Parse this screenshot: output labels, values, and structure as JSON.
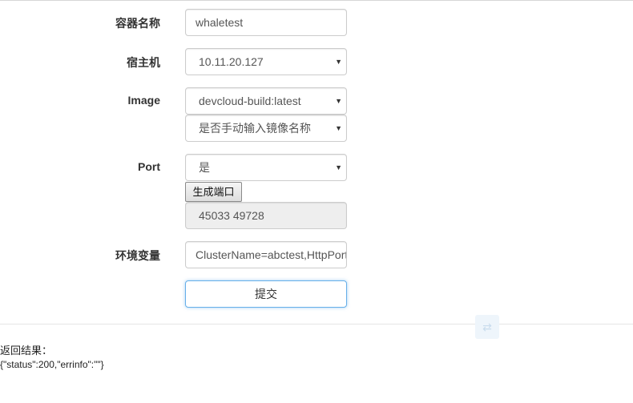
{
  "form": {
    "container_name": {
      "label": "容器名称",
      "value": "whaletest"
    },
    "host": {
      "label": "宿主机",
      "selected": "10.11.20.127"
    },
    "image": {
      "label": "Image",
      "selected": "devcloud-build:latest",
      "manual_selected": "是否手动输入镜像名称"
    },
    "port": {
      "label": "Port",
      "selected": "是",
      "generate_button": "生成端口",
      "ports_value": "45033 49728"
    },
    "env": {
      "label": "环境变量",
      "value": "ClusterName=abctest,HttpPort"
    },
    "submit_label": "提交"
  },
  "result": {
    "title": "返回结果：",
    "body": "{\"status\":200,\"errinfo\":\"\"}"
  },
  "icons": {
    "caret": "caret-down-icon",
    "ghost": "translate-icon"
  },
  "colors": {
    "focus_border": "#66afe9",
    "readonly_bg": "#eeeeee"
  }
}
